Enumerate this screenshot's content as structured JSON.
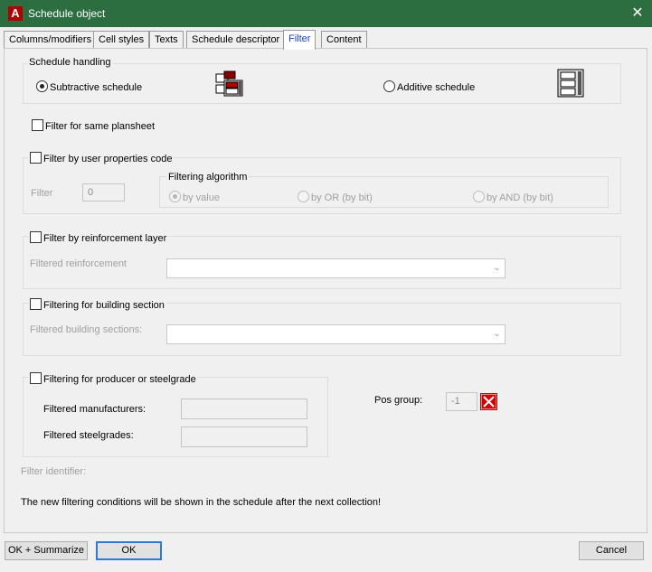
{
  "window": {
    "title": "Schedule object"
  },
  "tabs": [
    {
      "label": "Columns/modifiers"
    },
    {
      "label": "Cell styles"
    },
    {
      "label": "Texts"
    },
    {
      "label": "Schedule descriptor"
    },
    {
      "label": "Filter"
    },
    {
      "label": "Content"
    }
  ],
  "schedule_handling": {
    "legend": "Schedule handling",
    "subtractive": "Subtractive schedule",
    "additive": "Additive schedule"
  },
  "same_plansheet": {
    "label": "Filter for same plansheet"
  },
  "user_properties": {
    "label": "Filter by user properties code",
    "filter_label": "Filter",
    "filter_value": "0",
    "algorithm": {
      "legend": "Filtering algorithm",
      "by_value": "by value",
      "by_or": "by OR (by bit)",
      "by_and": "by AND (by bit)"
    }
  },
  "reinforcement_layer": {
    "label": "Filter by reinforcement layer",
    "filtered_label": "Filtered reinforcement"
  },
  "building_section": {
    "label": "Filtering for building section",
    "filtered_label": "Filtered building sections:"
  },
  "producer": {
    "label": "Filtering for producer or steelgrade",
    "manufacturers_label": "Filtered manufacturers:",
    "steelgrades_label": "Filtered steelgrades:"
  },
  "pos_group": {
    "label": "Pos group:",
    "value": "-1"
  },
  "filter_identifier": {
    "label": "Filter identifier:"
  },
  "note": "The new filtering conditions will be shown in the schedule after the next collection!",
  "buttons": {
    "ok_summarize": "OK + Summarize",
    "ok": "OK",
    "cancel": "Cancel"
  },
  "colors": {
    "titlebar": "#2c6e3f",
    "active_tab_text": "#1a3fbf",
    "red": "#c40000"
  }
}
